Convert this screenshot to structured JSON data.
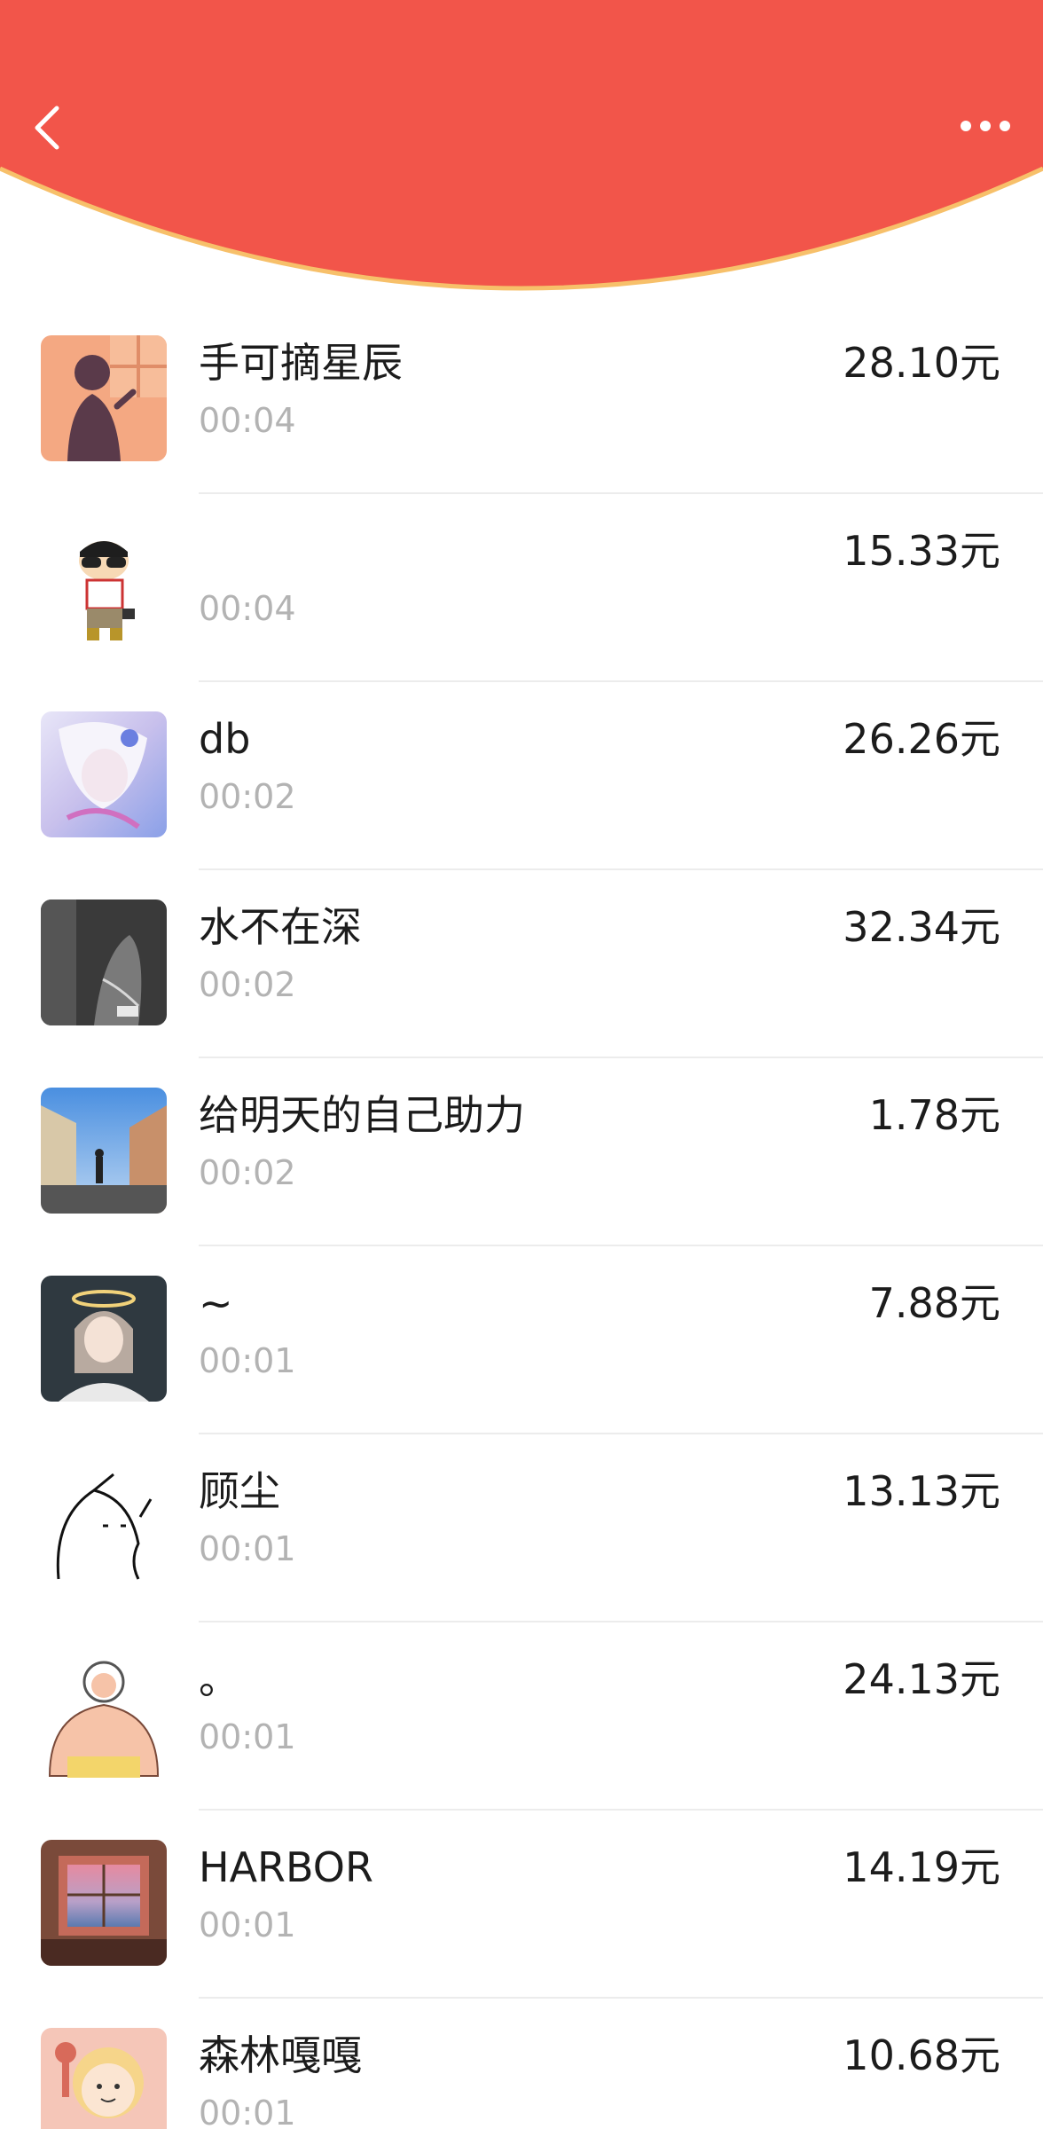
{
  "header": {
    "background_color": "#f2554a",
    "border_color": "#f7c06a",
    "back_icon": "chevron-left-icon",
    "more_icon": "more-horizontal-icon"
  },
  "items": [
    {
      "name": "手可摘星辰",
      "time": "00:04",
      "amount": "28.10元",
      "avatar_color": "#f4a882"
    },
    {
      "name": "",
      "time": "00:04",
      "amount": "15.33元",
      "avatar_color": "#ffffff"
    },
    {
      "name": "db",
      "time": "00:02",
      "amount": "26.26元",
      "avatar_color": "#c9c7f0"
    },
    {
      "name": "水不在深",
      "time": "00:02",
      "amount": "32.34元",
      "avatar_color": "#3a3a3a"
    },
    {
      "name": "给明天的自己助力",
      "time": "00:02",
      "amount": "1.78元",
      "avatar_color": "#7fb0e0"
    },
    {
      "name": "~",
      "time": "00:01",
      "amount": "7.88元",
      "avatar_color": "#2f3940"
    },
    {
      "name": "顾尘",
      "time": "00:01",
      "amount": "13.13元",
      "avatar_color": "#ffffff"
    },
    {
      "name": "。",
      "time": "00:01",
      "amount": "24.13元",
      "avatar_color": "#f6c3a8"
    },
    {
      "name": "HARBOR",
      "time": "00:01",
      "amount": "14.19元",
      "avatar_color": "#7a4a3a"
    },
    {
      "name": "森林嘎嘎",
      "time": "00:01",
      "amount": "10.68元",
      "avatar_color": "#f5c6b8"
    }
  ]
}
